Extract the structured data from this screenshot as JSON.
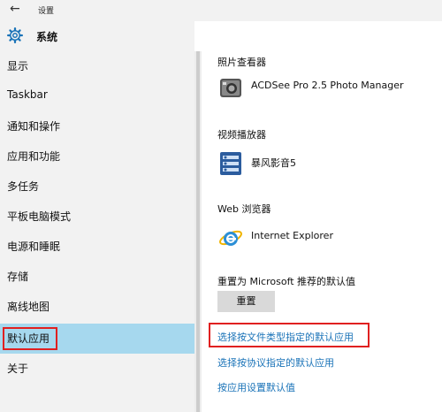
{
  "window": {
    "back_glyph": "←",
    "title": "设置"
  },
  "header": {
    "label": "系统"
  },
  "sidebar": {
    "items": [
      {
        "label": "显示"
      },
      {
        "label": "Taskbar"
      },
      {
        "label": "通知和操作"
      },
      {
        "label": "应用和功能"
      },
      {
        "label": "多任务"
      },
      {
        "label": "平板电脑模式"
      },
      {
        "label": "电源和睡眠"
      },
      {
        "label": "存储"
      },
      {
        "label": "离线地图"
      },
      {
        "label": "默认应用"
      },
      {
        "label": "关于"
      }
    ],
    "selected_index": 9
  },
  "content": {
    "photo_viewer": {
      "section": "照片查看器",
      "app": "ACDSee Pro 2.5 Photo Manager"
    },
    "video_player": {
      "section": "视频播放器",
      "app": "暴风影音5"
    },
    "web_browser": {
      "section": "Web 浏览器",
      "app": "Internet Explorer"
    },
    "reset": {
      "label": "重置为 Microsoft 推荐的默认值",
      "button": "重置"
    },
    "links": [
      {
        "label": "选择按文件类型指定的默认应用"
      },
      {
        "label": "选择按协议指定的默认应用"
      },
      {
        "label": "按应用设置默认值"
      }
    ]
  },
  "colors": {
    "accent": "#1a73b8",
    "selected_bg": "#a6d8ee",
    "highlight": "#e02020",
    "sidebar_bg": "#f2f2f2"
  }
}
